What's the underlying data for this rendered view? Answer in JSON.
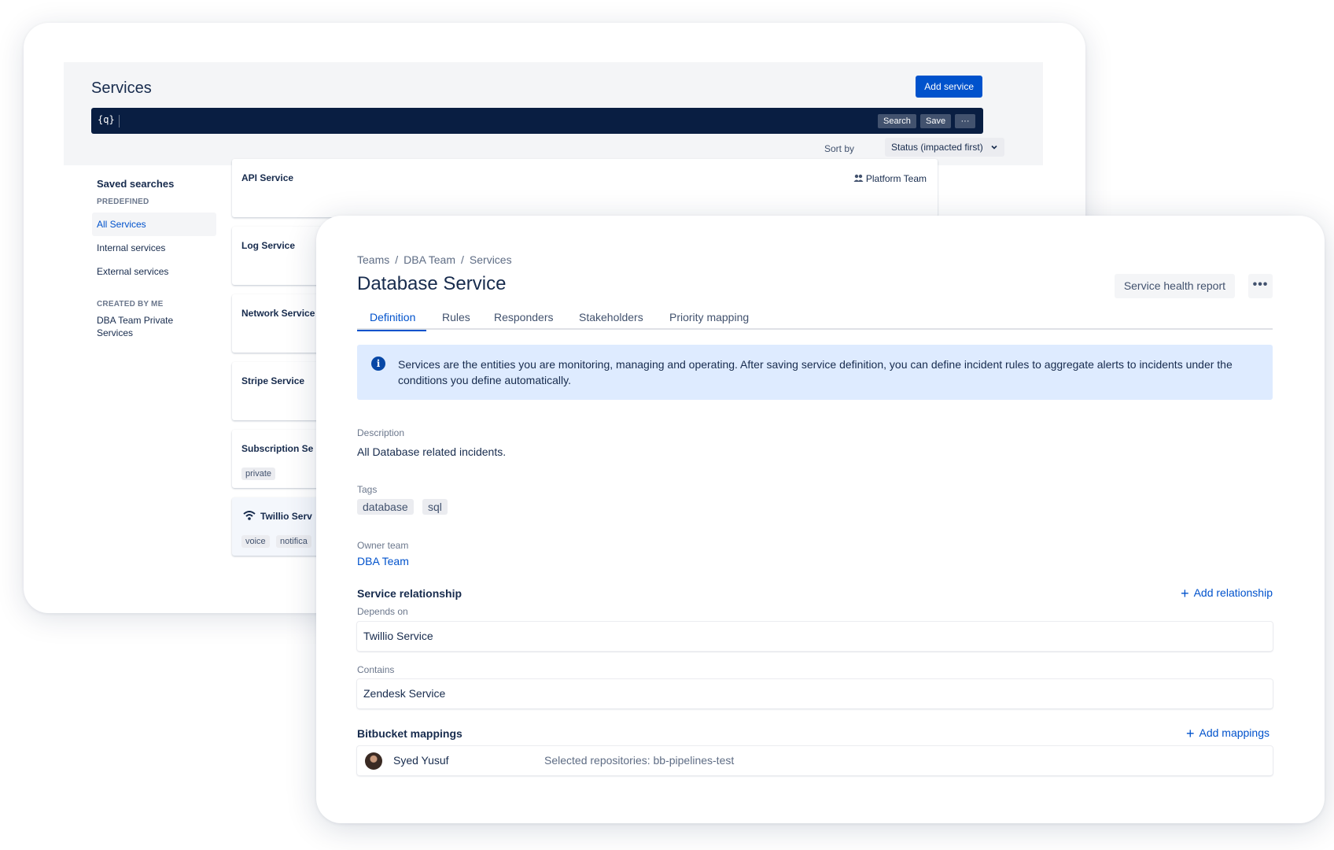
{
  "services_page": {
    "title": "Services",
    "add_service_label": "Add service",
    "query_icon": "{q}",
    "search_label": "Search",
    "save_label": "Save",
    "more_label": "···",
    "sort_label": "Sort by",
    "sort_value": "Status (impacted first)",
    "sidebar": {
      "title": "Saved searches",
      "predefined_label": "PREDEFINED",
      "predefined_items": [
        "All Services",
        "Internal services",
        "External services"
      ],
      "created_label": "CREATED BY ME",
      "created_items": [
        "DBA Team Private Services"
      ]
    },
    "services": [
      {
        "name": "API Service",
        "team": "Platform Team",
        "tags": []
      },
      {
        "name": "Log Service",
        "tags": []
      },
      {
        "name": "Network Service",
        "tags": []
      },
      {
        "name": "Stripe Service",
        "tags": []
      },
      {
        "name": "Subscription Se",
        "tags": [
          "private"
        ]
      },
      {
        "name": "Twillio Serv",
        "tags": [
          "voice",
          "notifica"
        ]
      }
    ]
  },
  "detail": {
    "breadcrumb": [
      "Teams",
      "DBA Team",
      "Services"
    ],
    "breadcrumb_sep": "/",
    "title": "Database Service",
    "health_report_label": "Service health report",
    "more_label": "•••",
    "tabs": [
      "Definition",
      "Rules",
      "Responders",
      "Stakeholders",
      "Priority mapping"
    ],
    "info_icon": "i",
    "info_text": "Services are the entities you are monitoring, managing and operating. After saving service definition, you can define incident rules to aggregate alerts to incidents under the conditions you define automatically.",
    "description_label": "Description",
    "description_value": "All Database related incidents.",
    "tags_label": "Tags",
    "tags": [
      "database",
      "sql"
    ],
    "owner_label": "Owner team",
    "owner_value": "DBA Team",
    "relationship_title": "Service relationship",
    "add_relationship_label": "Add relationship",
    "depends_label": "Depends on",
    "depends_value": "Twillio Service",
    "contains_label": "Contains",
    "contains_value": "Zendesk Service",
    "bitbucket_title": "Bitbucket mappings",
    "add_mappings_label": "Add mappings",
    "mapping_user": "Syed Yusuf",
    "mapping_repos": "Selected repositories: bb-pipelines-test",
    "plus_glyph": "+"
  },
  "colors": {
    "brand_blue": "#0052cc",
    "navy_bar": "#091e42",
    "info_bg": "#deebff"
  }
}
